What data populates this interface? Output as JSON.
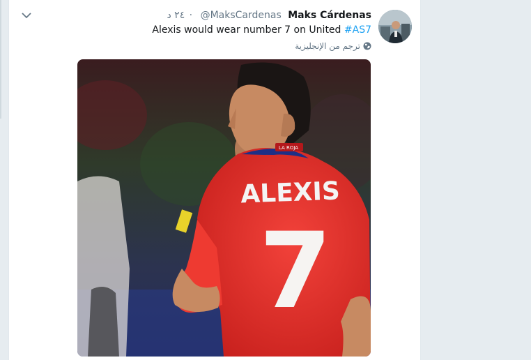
{
  "tweet": {
    "display_name": "Maks Cárdenas",
    "handle": "@MaksCardenas",
    "separator": "·",
    "time": "٢٤ د",
    "text_main": "Alexis would wear number 7 on United",
    "hashtag": "#AS7",
    "translate_label": "ترجم من الإنجليزية",
    "jersey_name": "ALEXIS",
    "jersey_number": "7",
    "collar_label": "LA ROJA"
  },
  "colors": {
    "link": "#1da1f2",
    "jersey": "#e8302a",
    "text_primary": "#14171a",
    "text_secondary": "#657786"
  },
  "icons": {
    "chevron": "chevron-down-icon",
    "globe": "globe-icon"
  }
}
